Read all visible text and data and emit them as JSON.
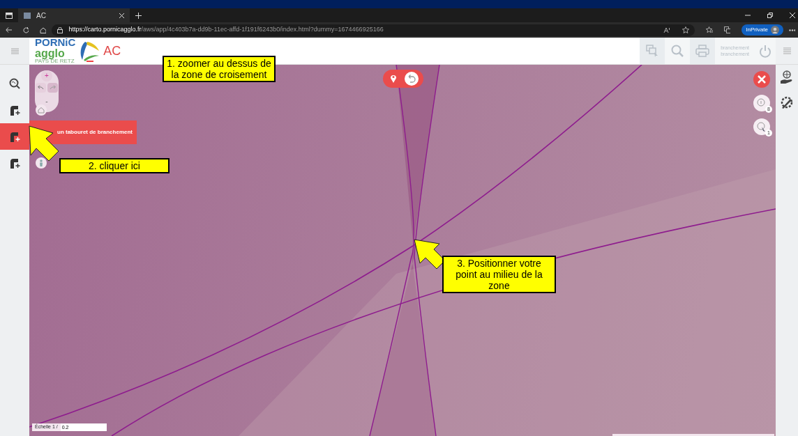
{
  "browser": {
    "tab_title": "AC",
    "url_host": "https://carto.pornicagglo.fr",
    "url_path": "/aws/app/4c403b7a-dd9b-11ec-affd-1f191f6243b0/index.html?dummy=1674466925166",
    "inprivate": "InPrivate"
  },
  "header": {
    "logo_lines": [
      "PORNiC",
      "agglo",
      "PAYS DE RETZ"
    ],
    "app_name": "AC",
    "user_lines": [
      "branchement",
      "branchement"
    ]
  },
  "left_tools": [
    {
      "selected": false
    },
    {
      "selected": false
    },
    {
      "selected": true
    },
    {
      "selected": false
    }
  ],
  "tooltip": "un tabouret de branchement",
  "map_controls": {
    "zoom_in": "+",
    "zoom_out": "-"
  },
  "map_buttons": [
    {
      "kind": "tools"
    },
    {
      "kind": "info",
      "count": "8"
    },
    {
      "kind": "select",
      "count": "1"
    }
  ],
  "scale": {
    "label": "Échelle 1 /",
    "value": "0.2"
  },
  "annotations": [
    {
      "text": "1. zoomer au dessus de la zone de croisement",
      "arrow": false
    },
    {
      "text": "2. cliquer ici",
      "arrow": true
    },
    {
      "text": "3. Positionner votre point au milieu de la zone",
      "arrow": true
    }
  ]
}
